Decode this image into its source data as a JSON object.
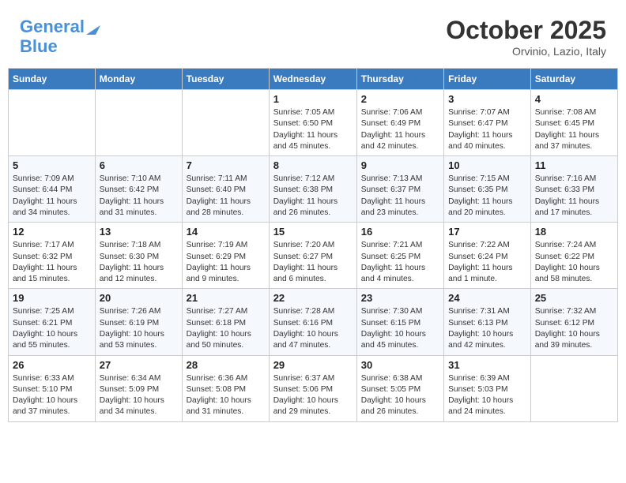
{
  "header": {
    "logo_line1": "General",
    "logo_line2": "Blue",
    "month": "October 2025",
    "location": "Orvinio, Lazio, Italy"
  },
  "days_of_week": [
    "Sunday",
    "Monday",
    "Tuesday",
    "Wednesday",
    "Thursday",
    "Friday",
    "Saturday"
  ],
  "weeks": [
    [
      {
        "day": "",
        "info": ""
      },
      {
        "day": "",
        "info": ""
      },
      {
        "day": "",
        "info": ""
      },
      {
        "day": "1",
        "info": "Sunrise: 7:05 AM\nSunset: 6:50 PM\nDaylight: 11 hours and 45 minutes."
      },
      {
        "day": "2",
        "info": "Sunrise: 7:06 AM\nSunset: 6:49 PM\nDaylight: 11 hours and 42 minutes."
      },
      {
        "day": "3",
        "info": "Sunrise: 7:07 AM\nSunset: 6:47 PM\nDaylight: 11 hours and 40 minutes."
      },
      {
        "day": "4",
        "info": "Sunrise: 7:08 AM\nSunset: 6:45 PM\nDaylight: 11 hours and 37 minutes."
      }
    ],
    [
      {
        "day": "5",
        "info": "Sunrise: 7:09 AM\nSunset: 6:44 PM\nDaylight: 11 hours and 34 minutes."
      },
      {
        "day": "6",
        "info": "Sunrise: 7:10 AM\nSunset: 6:42 PM\nDaylight: 11 hours and 31 minutes."
      },
      {
        "day": "7",
        "info": "Sunrise: 7:11 AM\nSunset: 6:40 PM\nDaylight: 11 hours and 28 minutes."
      },
      {
        "day": "8",
        "info": "Sunrise: 7:12 AM\nSunset: 6:38 PM\nDaylight: 11 hours and 26 minutes."
      },
      {
        "day": "9",
        "info": "Sunrise: 7:13 AM\nSunset: 6:37 PM\nDaylight: 11 hours and 23 minutes."
      },
      {
        "day": "10",
        "info": "Sunrise: 7:15 AM\nSunset: 6:35 PM\nDaylight: 11 hours and 20 minutes."
      },
      {
        "day": "11",
        "info": "Sunrise: 7:16 AM\nSunset: 6:33 PM\nDaylight: 11 hours and 17 minutes."
      }
    ],
    [
      {
        "day": "12",
        "info": "Sunrise: 7:17 AM\nSunset: 6:32 PM\nDaylight: 11 hours and 15 minutes."
      },
      {
        "day": "13",
        "info": "Sunrise: 7:18 AM\nSunset: 6:30 PM\nDaylight: 11 hours and 12 minutes."
      },
      {
        "day": "14",
        "info": "Sunrise: 7:19 AM\nSunset: 6:29 PM\nDaylight: 11 hours and 9 minutes."
      },
      {
        "day": "15",
        "info": "Sunrise: 7:20 AM\nSunset: 6:27 PM\nDaylight: 11 hours and 6 minutes."
      },
      {
        "day": "16",
        "info": "Sunrise: 7:21 AM\nSunset: 6:25 PM\nDaylight: 11 hours and 4 minutes."
      },
      {
        "day": "17",
        "info": "Sunrise: 7:22 AM\nSunset: 6:24 PM\nDaylight: 11 hours and 1 minute."
      },
      {
        "day": "18",
        "info": "Sunrise: 7:24 AM\nSunset: 6:22 PM\nDaylight: 10 hours and 58 minutes."
      }
    ],
    [
      {
        "day": "19",
        "info": "Sunrise: 7:25 AM\nSunset: 6:21 PM\nDaylight: 10 hours and 55 minutes."
      },
      {
        "day": "20",
        "info": "Sunrise: 7:26 AM\nSunset: 6:19 PM\nDaylight: 10 hours and 53 minutes."
      },
      {
        "day": "21",
        "info": "Sunrise: 7:27 AM\nSunset: 6:18 PM\nDaylight: 10 hours and 50 minutes."
      },
      {
        "day": "22",
        "info": "Sunrise: 7:28 AM\nSunset: 6:16 PM\nDaylight: 10 hours and 47 minutes."
      },
      {
        "day": "23",
        "info": "Sunrise: 7:30 AM\nSunset: 6:15 PM\nDaylight: 10 hours and 45 minutes."
      },
      {
        "day": "24",
        "info": "Sunrise: 7:31 AM\nSunset: 6:13 PM\nDaylight: 10 hours and 42 minutes."
      },
      {
        "day": "25",
        "info": "Sunrise: 7:32 AM\nSunset: 6:12 PM\nDaylight: 10 hours and 39 minutes."
      }
    ],
    [
      {
        "day": "26",
        "info": "Sunrise: 6:33 AM\nSunset: 5:10 PM\nDaylight: 10 hours and 37 minutes."
      },
      {
        "day": "27",
        "info": "Sunrise: 6:34 AM\nSunset: 5:09 PM\nDaylight: 10 hours and 34 minutes."
      },
      {
        "day": "28",
        "info": "Sunrise: 6:36 AM\nSunset: 5:08 PM\nDaylight: 10 hours and 31 minutes."
      },
      {
        "day": "29",
        "info": "Sunrise: 6:37 AM\nSunset: 5:06 PM\nDaylight: 10 hours and 29 minutes."
      },
      {
        "day": "30",
        "info": "Sunrise: 6:38 AM\nSunset: 5:05 PM\nDaylight: 10 hours and 26 minutes."
      },
      {
        "day": "31",
        "info": "Sunrise: 6:39 AM\nSunset: 5:03 PM\nDaylight: 10 hours and 24 minutes."
      },
      {
        "day": "",
        "info": ""
      }
    ]
  ]
}
